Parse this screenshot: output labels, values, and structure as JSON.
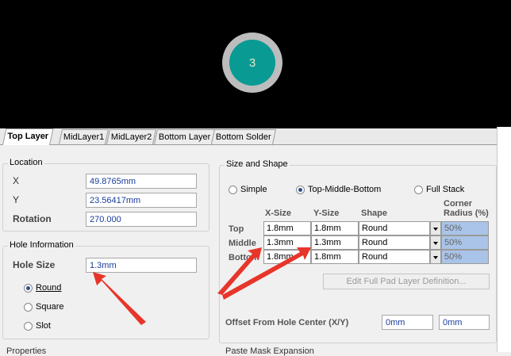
{
  "preview": {
    "pad_number": "3"
  },
  "tabs": [
    "Top Layer",
    "MidLayer1",
    "MidLayer2",
    "Bottom Layer",
    "Bottom Solder"
  ],
  "location": {
    "title": "Location",
    "x_label": "X",
    "x_value": "49.8765mm",
    "y_label": "Y",
    "y_value": "23.56417mm",
    "rotation_label": "Rotation",
    "rotation_value": "270.000"
  },
  "hole": {
    "title": "Hole Information",
    "size_label": "Hole Size",
    "size_value": "1.3mm",
    "opt_round": "Round",
    "opt_square": "Square",
    "opt_slot": "Slot",
    "selected": "Round"
  },
  "size_shape": {
    "title": "Size and Shape",
    "mode_simple": "Simple",
    "mode_tmb": "Top-Middle-Bottom",
    "mode_full": "Full Stack",
    "selected_mode": "Top-Middle-Bottom",
    "headers": {
      "xsize": "X-Size",
      "ysize": "Y-Size",
      "shape": "Shape",
      "corner1": "Corner",
      "corner2": "Radius (%)"
    },
    "rows": [
      {
        "label": "Top",
        "x": "1.8mm",
        "y": "1.8mm",
        "shape": "Round",
        "corner": "50%"
      },
      {
        "label": "Middle",
        "x": "1.3mm",
        "y": "1.3mm",
        "shape": "Round",
        "corner": "50%"
      },
      {
        "label": "Bottom",
        "x": "1.8mm",
        "y": "1.8mm",
        "shape": "Round",
        "corner": "50%"
      }
    ],
    "edit_button": "Edit Full Pad Layer Definition...",
    "offset_label": "Offset From Hole Center (X/Y)",
    "offset_x": "0mm",
    "offset_y": "0mm"
  },
  "bottom": {
    "left": "Properties",
    "right": "Paste Mask Expansion"
  },
  "colors": {
    "pad_copper": "#0a9a94",
    "pad_ring": "#bdbdbd",
    "annotation_arrow": "#e8352a"
  }
}
